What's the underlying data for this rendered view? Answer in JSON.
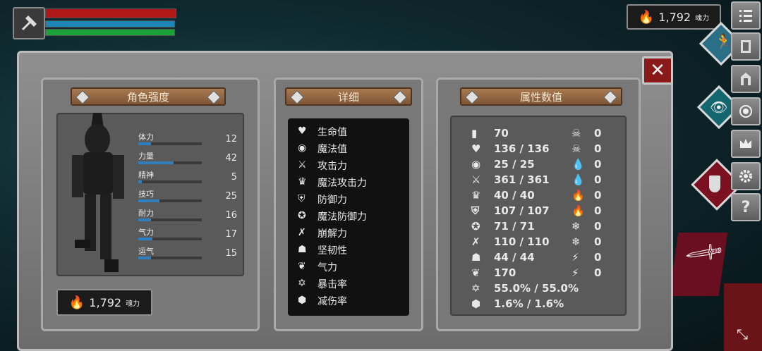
{
  "hud": {
    "weapon_icon": "axe-icon",
    "bars": {
      "health_color": "#b01818",
      "mana_color": "#1d86b8",
      "stamina_color": "#1aa238"
    },
    "soul_top": {
      "value": "1,792",
      "unit": "魂力"
    }
  },
  "panel": {
    "character": {
      "title": "角色强度",
      "stats": [
        {
          "label": "体力",
          "value": "12",
          "fill": 0.2
        },
        {
          "label": "力量",
          "value": "42",
          "fill": 0.55
        },
        {
          "label": "精神",
          "value": "5",
          "fill": 0.05
        },
        {
          "label": "技巧",
          "value": "25",
          "fill": 0.33
        },
        {
          "label": "耐力",
          "value": "16",
          "fill": 0.2
        },
        {
          "label": "气力",
          "value": "17",
          "fill": 0.22
        },
        {
          "label": "运气",
          "value": "15",
          "fill": 0.2
        }
      ],
      "soul": {
        "value": "1,792",
        "unit": "魂力"
      }
    },
    "details": {
      "title": "详细",
      "items": [
        {
          "label": "生命值",
          "icon": "heart-icon"
        },
        {
          "label": "魔法值",
          "icon": "brain-icon"
        },
        {
          "label": "攻击力",
          "icon": "sword-icon"
        },
        {
          "label": "魔法攻击力",
          "icon": "crown-magic-icon"
        },
        {
          "label": "防御力",
          "icon": "shield-icon"
        },
        {
          "label": "魔法防御力",
          "icon": "magic-shield-icon"
        },
        {
          "label": "崩解力",
          "icon": "break-icon"
        },
        {
          "label": "坚韧性",
          "icon": "helmet-icon"
        },
        {
          "label": "气力",
          "icon": "lungs-icon"
        },
        {
          "label": "暴击率",
          "icon": "star-burst-icon"
        },
        {
          "label": "减伤率",
          "icon": "guard-icon"
        }
      ]
    },
    "attributes": {
      "title": "属性数值",
      "left": [
        {
          "icon": "weight-icon",
          "value": "70"
        },
        {
          "icon": "heart-icon",
          "value": "136 / 136"
        },
        {
          "icon": "brain-icon",
          "value": "25 / 25"
        },
        {
          "icon": "sword-icon",
          "value": "361 / 361"
        },
        {
          "icon": "crown-magic-icon",
          "value": "40 / 40"
        },
        {
          "icon": "shield-icon",
          "value": "107 / 107"
        },
        {
          "icon": "magic-shield-icon",
          "value": "71 / 71"
        },
        {
          "icon": "break-icon",
          "value": "110 / 110"
        },
        {
          "icon": "helmet-icon",
          "value": "44 / 44"
        },
        {
          "icon": "lungs-icon",
          "value": "170"
        },
        {
          "icon": "star-burst-icon",
          "value": "55.0% / 55.0%"
        },
        {
          "icon": "guard-icon",
          "value": "1.6% / 1.6%"
        }
      ],
      "right": [
        {
          "icon": "skull-icon",
          "value": "0"
        },
        {
          "icon": "skull-crossed-icon",
          "value": "0"
        },
        {
          "icon": "blood-drop-icon",
          "value": "0"
        },
        {
          "icon": "drop-icon",
          "value": "0"
        },
        {
          "icon": "fire-icon",
          "value": "0"
        },
        {
          "icon": "fire-crossed-icon",
          "value": "0"
        },
        {
          "icon": "snowflake-icon",
          "value": "0"
        },
        {
          "icon": "snowflake-crossed-icon",
          "value": "0"
        },
        {
          "icon": "lightning-icon",
          "value": "0"
        },
        {
          "icon": "lightning-crossed-icon",
          "value": "0"
        }
      ]
    }
  },
  "side_buttons": [
    "menu-icon",
    "skills-icon",
    "door-icon",
    "inventory-icon",
    "eye-icon",
    "coin-icon",
    "crown-icon",
    "gear-icon",
    "help-icon"
  ],
  "help_label": "?"
}
